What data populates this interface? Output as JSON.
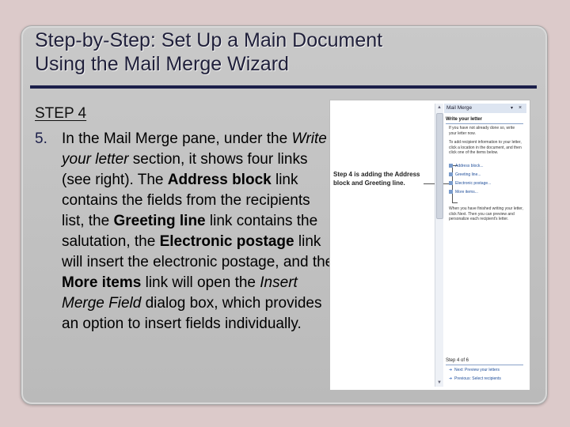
{
  "slide": {
    "title_line1": "Step-by-Step: Set Up a Main Document",
    "title_line2": "Using the Mail Merge Wizard",
    "step_label": "STEP 4",
    "item_number": "5.",
    "body": {
      "t1": "In the Mail Merge pane, under the ",
      "t2": "Write your letter",
      "t3": " section, it shows four links (see right). The ",
      "t4": "Address block",
      "t5": " link contains the fields from the recipients list, the ",
      "t6": "Greeting line",
      "t7": " link contains the salutation, the ",
      "t8": "Electronic postage",
      "t9": " link will insert the electronic postage, and the ",
      "t10": "More items",
      "t11": " link will open the ",
      "t12": "Insert Merge Field",
      "t13": " dialog box, which provides an option to insert fields individually."
    }
  },
  "screenshot": {
    "callout": "Step 4 is adding the Address block and Greeting line.",
    "pane_title": "Mail Merge",
    "section_title": "Write your letter",
    "para1": "If you have not already done so, write your letter now.",
    "para2": "To add recipient information to your letter, click a location in the document, and then click one of the items below.",
    "links": [
      "Address block...",
      "Greeting line...",
      "Electronic postage...",
      "More items..."
    ],
    "para3": "When you have finished writing your letter, click Next. Then you can preview and personalize each recipient's letter.",
    "step_of": "Step 4 of 6",
    "next_link": "Next: Preview your letters",
    "prev_link": "Previous: Select recipients"
  },
  "colors": {
    "background": "#dccaca",
    "slide": "#c4c4c4",
    "title_rule": "#1b1f4a",
    "link": "#1f4e9a"
  }
}
